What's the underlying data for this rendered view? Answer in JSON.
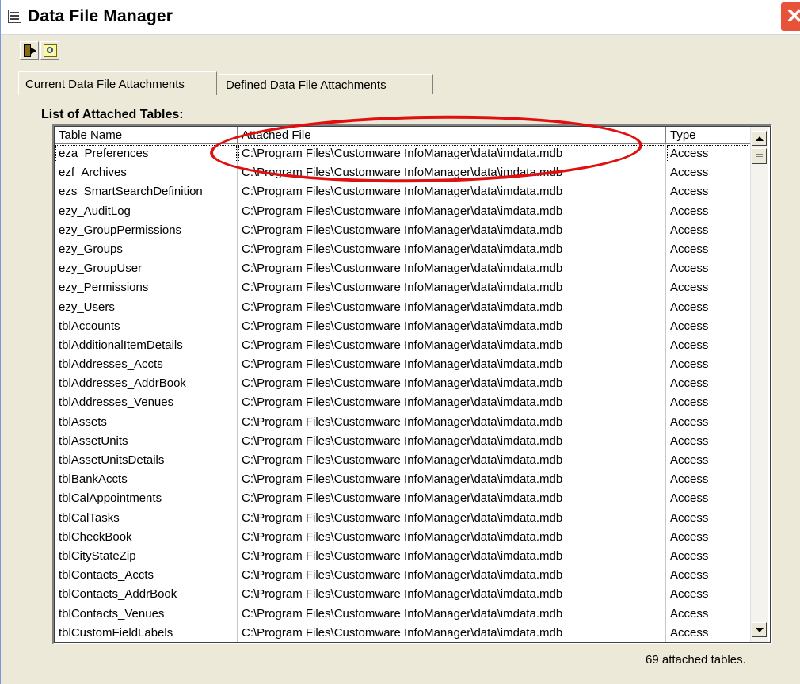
{
  "window": {
    "title": "Data File Manager"
  },
  "toolbar": {
    "buttons": [
      "exit-icon",
      "find-icon"
    ]
  },
  "tabs": [
    {
      "label": "Current Data File Attachments",
      "active": true
    },
    {
      "label": "Defined Data File Attachments",
      "active": false
    }
  ],
  "list": {
    "label": "List of Attached Tables:",
    "columns": [
      "Table Name",
      "Attached File",
      "Type"
    ],
    "rows": [
      [
        "eza_Preferences",
        "C:\\Program Files\\Customware InfoManager\\data\\imdata.mdb",
        "Access"
      ],
      [
        "ezf_Archives",
        "C:\\Program Files\\Customware InfoManager\\data\\imdata.mdb",
        "Access"
      ],
      [
        "ezs_SmartSearchDefinition",
        "C:\\Program Files\\Customware InfoManager\\data\\imdata.mdb",
        "Access"
      ],
      [
        "ezy_AuditLog",
        "C:\\Program Files\\Customware InfoManager\\data\\imdata.mdb",
        "Access"
      ],
      [
        "ezy_GroupPermissions",
        "C:\\Program Files\\Customware InfoManager\\data\\imdata.mdb",
        "Access"
      ],
      [
        "ezy_Groups",
        "C:\\Program Files\\Customware InfoManager\\data\\imdata.mdb",
        "Access"
      ],
      [
        "ezy_GroupUser",
        "C:\\Program Files\\Customware InfoManager\\data\\imdata.mdb",
        "Access"
      ],
      [
        "ezy_Permissions",
        "C:\\Program Files\\Customware InfoManager\\data\\imdata.mdb",
        "Access"
      ],
      [
        "ezy_Users",
        "C:\\Program Files\\Customware InfoManager\\data\\imdata.mdb",
        "Access"
      ],
      [
        "tblAccounts",
        "C:\\Program Files\\Customware InfoManager\\data\\imdata.mdb",
        "Access"
      ],
      [
        "tblAdditionalItemDetails",
        "C:\\Program Files\\Customware InfoManager\\data\\imdata.mdb",
        "Access"
      ],
      [
        "tblAddresses_Accts",
        "C:\\Program Files\\Customware InfoManager\\data\\imdata.mdb",
        "Access"
      ],
      [
        "tblAddresses_AddrBook",
        "C:\\Program Files\\Customware InfoManager\\data\\imdata.mdb",
        "Access"
      ],
      [
        "tblAddresses_Venues",
        "C:\\Program Files\\Customware InfoManager\\data\\imdata.mdb",
        "Access"
      ],
      [
        "tblAssets",
        "C:\\Program Files\\Customware InfoManager\\data\\imdata.mdb",
        "Access"
      ],
      [
        "tblAssetUnits",
        "C:\\Program Files\\Customware InfoManager\\data\\imdata.mdb",
        "Access"
      ],
      [
        "tblAssetUnitsDetails",
        "C:\\Program Files\\Customware InfoManager\\data\\imdata.mdb",
        "Access"
      ],
      [
        "tblBankAccts",
        "C:\\Program Files\\Customware InfoManager\\data\\imdata.mdb",
        "Access"
      ],
      [
        "tblCalAppointments",
        "C:\\Program Files\\Customware InfoManager\\data\\imdata.mdb",
        "Access"
      ],
      [
        "tblCalTasks",
        "C:\\Program Files\\Customware InfoManager\\data\\imdata.mdb",
        "Access"
      ],
      [
        "tblCheckBook",
        "C:\\Program Files\\Customware InfoManager\\data\\imdata.mdb",
        "Access"
      ],
      [
        "tblCityStateZip",
        "C:\\Program Files\\Customware InfoManager\\data\\imdata.mdb",
        "Access"
      ],
      [
        "tblContacts_Accts",
        "C:\\Program Files\\Customware InfoManager\\data\\imdata.mdb",
        "Access"
      ],
      [
        "tblContacts_AddrBook",
        "C:\\Program Files\\Customware InfoManager\\data\\imdata.mdb",
        "Access"
      ],
      [
        "tblContacts_Venues",
        "C:\\Program Files\\Customware InfoManager\\data\\imdata.mdb",
        "Access"
      ],
      [
        "tblCustomFieldLabels",
        "C:\\Program Files\\Customware InfoManager\\data\\imdata.mdb",
        "Access"
      ]
    ]
  },
  "status": {
    "text": "69 attached tables."
  },
  "colors": {
    "highlight": "#e01010",
    "close_button": "#e7523a",
    "window_bg": "#ece9d8"
  }
}
